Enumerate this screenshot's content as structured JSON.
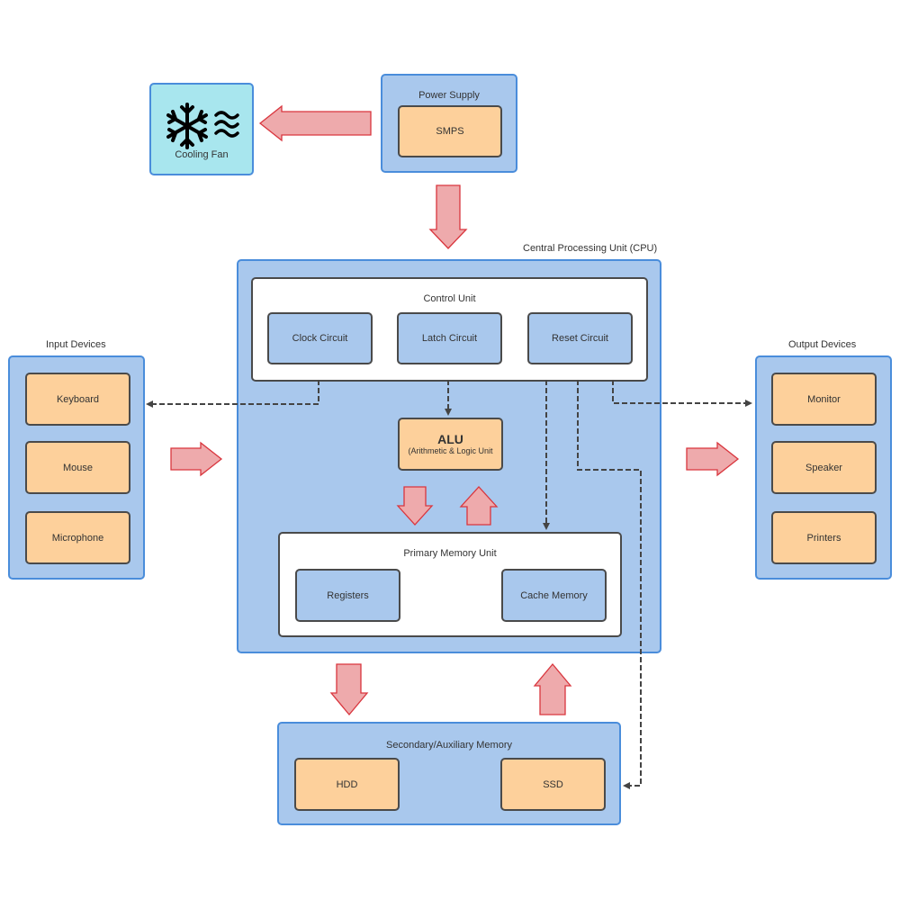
{
  "cooling_fan": {
    "label": "Cooling Fan",
    "icon": "snowflake-wind-icon"
  },
  "power_supply": {
    "title": "Power Supply",
    "component": "SMPS"
  },
  "cpu": {
    "title": "Central Processing Unit (CPU)",
    "control_unit": {
      "title": "Control Unit",
      "components": [
        "Clock Circuit",
        "Latch Circuit",
        "Reset Circuit"
      ]
    },
    "alu": {
      "title": "ALU",
      "subtitle": "(Arithmetic & Logic Unit"
    },
    "primary_memory": {
      "title": "Primary Memory Unit",
      "components": [
        "Registers",
        "Cache Memory"
      ]
    }
  },
  "input_devices": {
    "title": "Input Devices",
    "items": [
      "Keyboard",
      "Mouse",
      "Microphone"
    ]
  },
  "output_devices": {
    "title": "Output Devices",
    "items": [
      "Monitor",
      "Speaker",
      "Printers"
    ]
  },
  "secondary_memory": {
    "title": "Secondary/Auxiliary Memory",
    "items": [
      "HDD",
      "SSD"
    ]
  },
  "colors": {
    "container_fill": "#a9c8ed",
    "container_border": "#4a8ddb",
    "component_orange": "#fdd09b",
    "arrow_fill": "#eeaaac",
    "arrow_stroke": "#d9363e",
    "connector": "#444444",
    "cooling_fill": "#a8e6ee"
  }
}
